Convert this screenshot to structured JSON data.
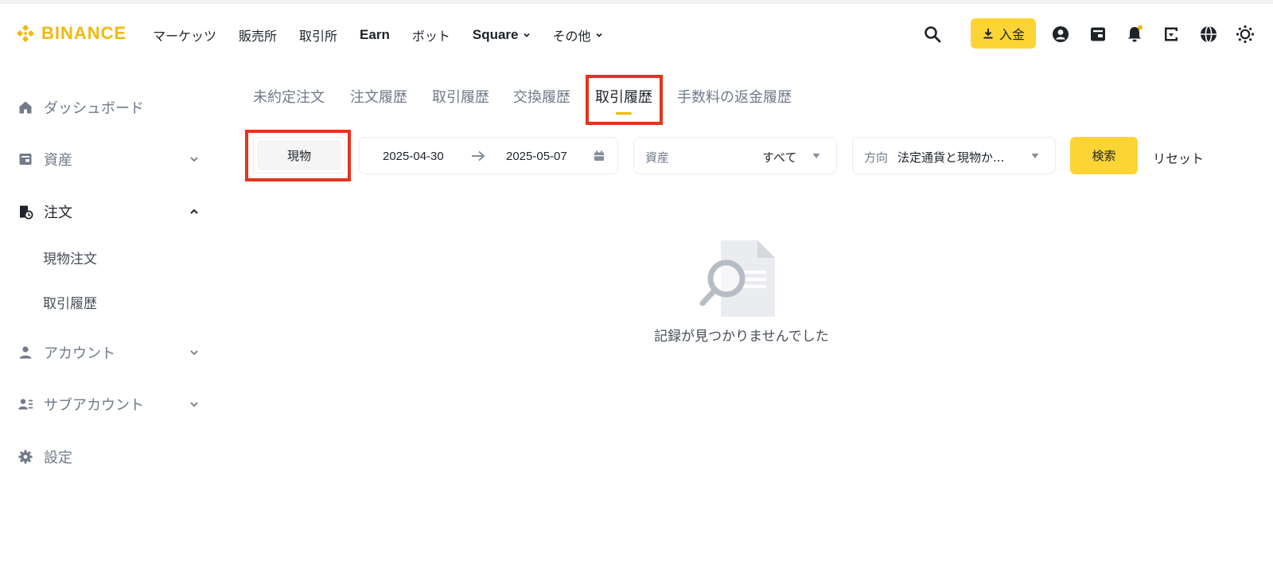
{
  "brand": {
    "name": "BINANCE",
    "color": "#f0b90b"
  },
  "nav": {
    "items": [
      {
        "label": "マーケッツ"
      },
      {
        "label": "販売所"
      },
      {
        "label": "取引所"
      },
      {
        "label": "Earn"
      },
      {
        "label": "ボット"
      },
      {
        "label": "Square"
      },
      {
        "label": "その他"
      }
    ]
  },
  "header": {
    "deposit_label": "入金",
    "icons": [
      "search-icon",
      "deposit-download-icon",
      "user-profile-icon",
      "wallet-icon",
      "notification-bell-icon",
      "download-app-icon",
      "language-globe-icon",
      "theme-toggle-icon"
    ],
    "notification_dot_color": "#f0b90b"
  },
  "sidebar": {
    "items": [
      {
        "label": "ダッシュボード",
        "icon": "home-icon"
      },
      {
        "label": "資産",
        "icon": "wallet-icon"
      },
      {
        "label": "注文",
        "icon": "order-icon"
      },
      {
        "label": "アカウント",
        "icon": "user-icon"
      },
      {
        "label": "サブアカウント",
        "icon": "sub-account-icon"
      },
      {
        "label": "設定",
        "icon": "gear-icon"
      }
    ],
    "sub_items": [
      {
        "label": "現物注文"
      },
      {
        "label": "取引履歴"
      }
    ]
  },
  "tabs": [
    {
      "label": "未約定注文"
    },
    {
      "label": "注文履歴"
    },
    {
      "label": "取引履歴"
    },
    {
      "label": "交換履歴"
    },
    {
      "label": "取引履歴",
      "active": true
    },
    {
      "label": "手数料の返金履歴"
    }
  ],
  "filters": {
    "market_type": "現物",
    "date_from": "2025-04-30",
    "date_to": "2025-05-07",
    "asset_label": "資産",
    "asset_value": "すべて",
    "direction_label": "方向",
    "direction_value": "法定通貨と現物か...",
    "search_label": "検索",
    "reset_label": "リセット"
  },
  "empty_state": {
    "message": "記録が見つかりませんでした"
  },
  "colors": {
    "accent": "#fcd535",
    "highlight": "#e8321b",
    "text": "#1e2329",
    "muted": "#707a8a"
  }
}
